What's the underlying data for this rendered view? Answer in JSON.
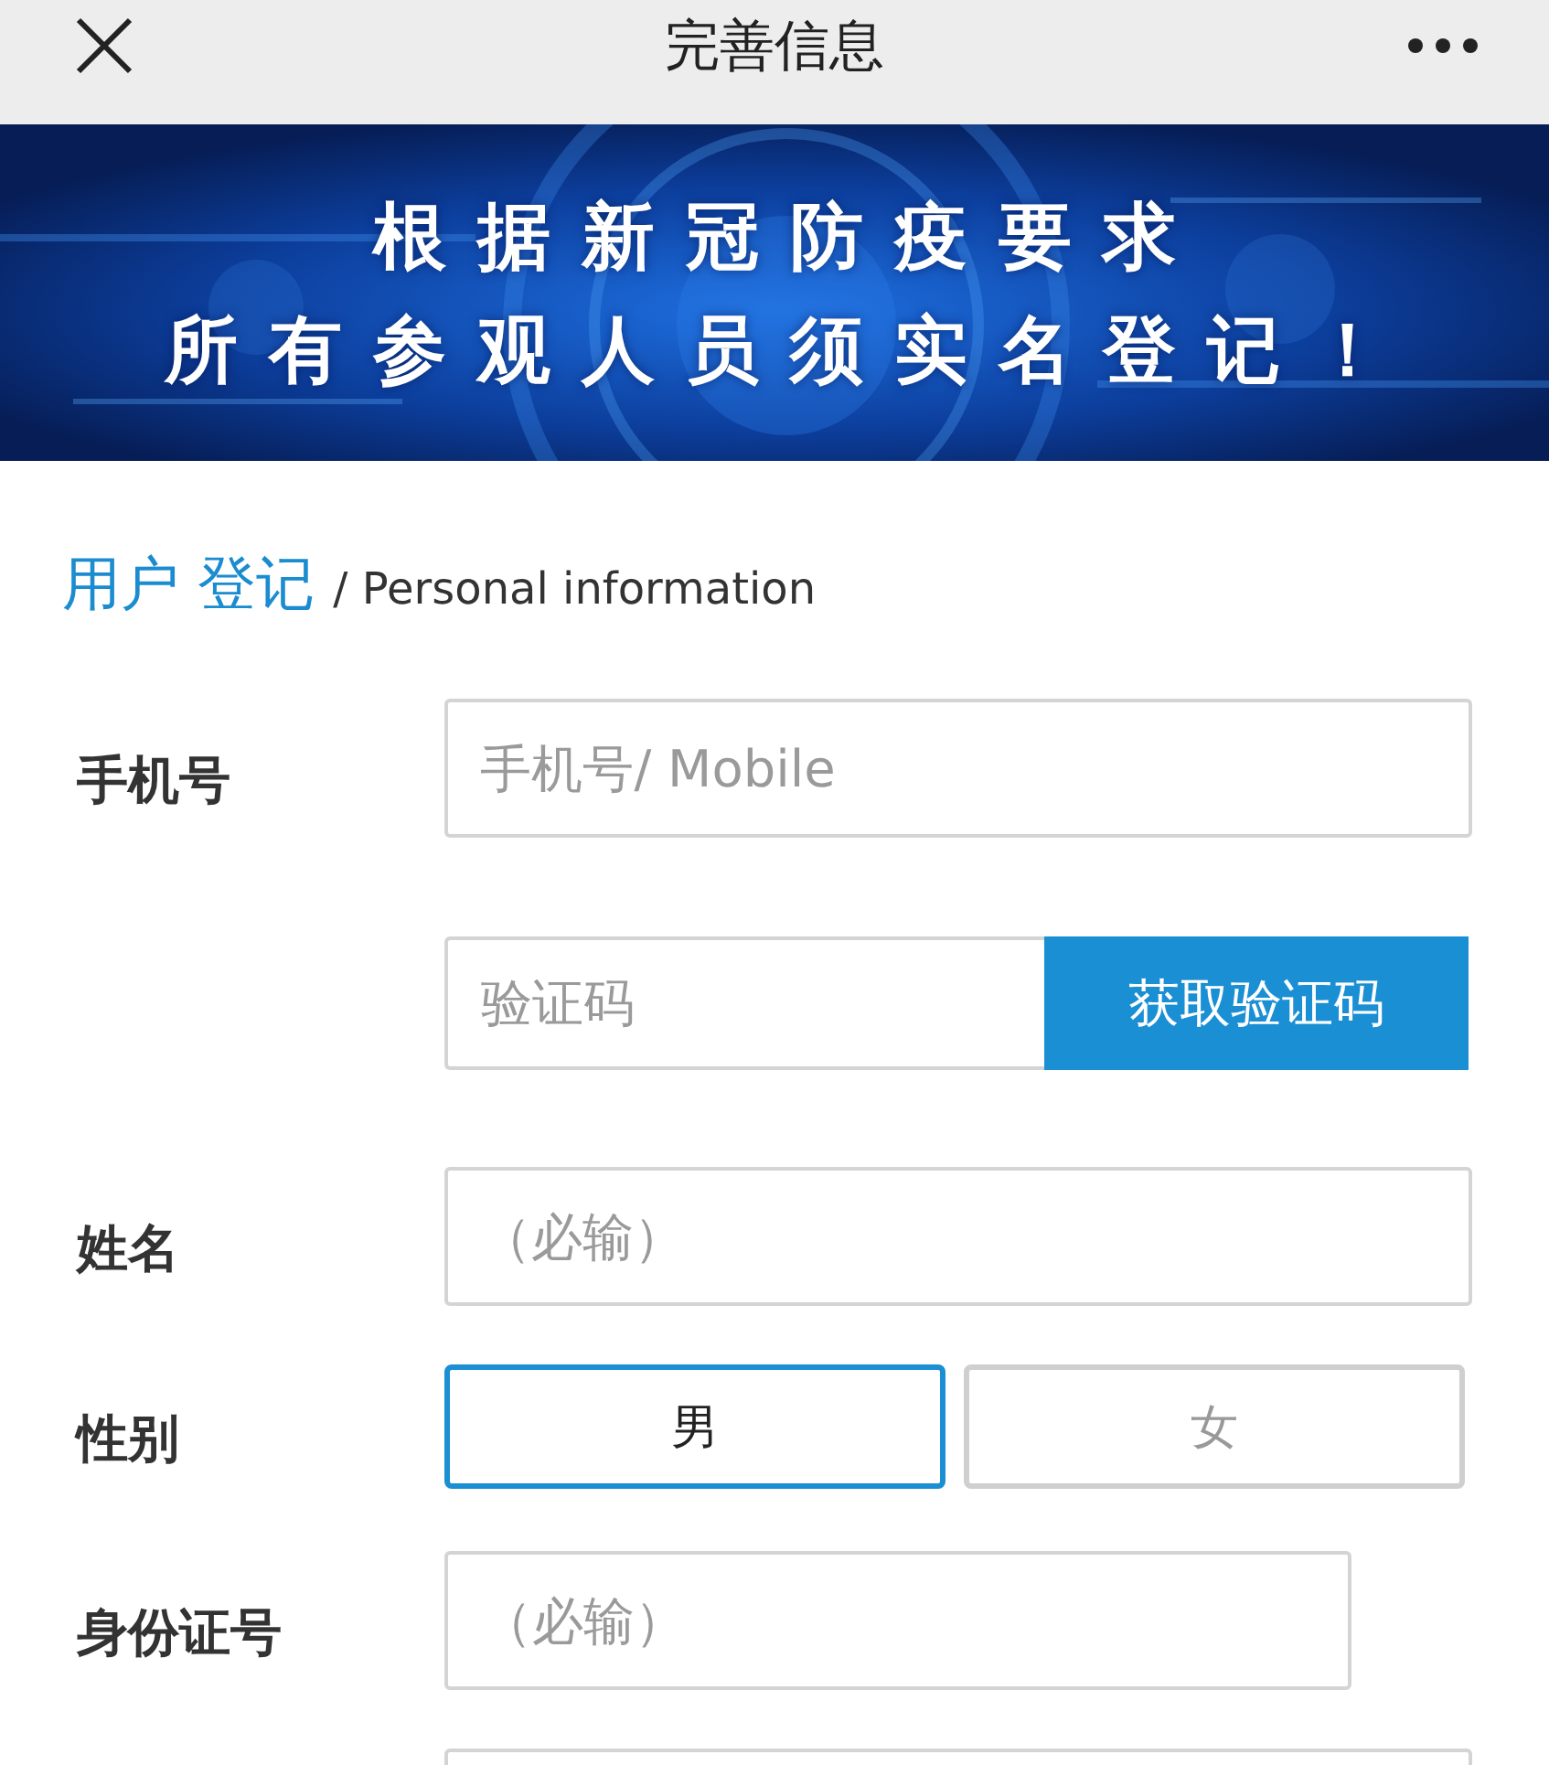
{
  "header": {
    "title": "完善信息"
  },
  "banner": {
    "kind": "picture",
    "lines": [
      "根据新冠防疫要求",
      "所有参观人员须实名登记！"
    ]
  },
  "section_title": {
    "highlight": "用户 登记",
    "subtitle": "/ Personal information"
  },
  "rows": [
    {
      "kind": "text",
      "label": "手机号",
      "placeholder": "手机号/ Mobile"
    },
    {
      "kind": "code",
      "placeholder": "验证码",
      "button": "获取验证码"
    },
    {
      "kind": "text",
      "label": "姓名",
      "placeholder": "（必输）"
    },
    {
      "kind": "choice",
      "label": "性别",
      "options": [
        {
          "label": "男",
          "selected": true
        },
        {
          "label": "女",
          "selected": false
        }
      ]
    },
    {
      "kind": "text",
      "label": "身份证号",
      "placeholder": "（必输）",
      "short": true
    },
    {
      "kind": "text"
    }
  ]
}
